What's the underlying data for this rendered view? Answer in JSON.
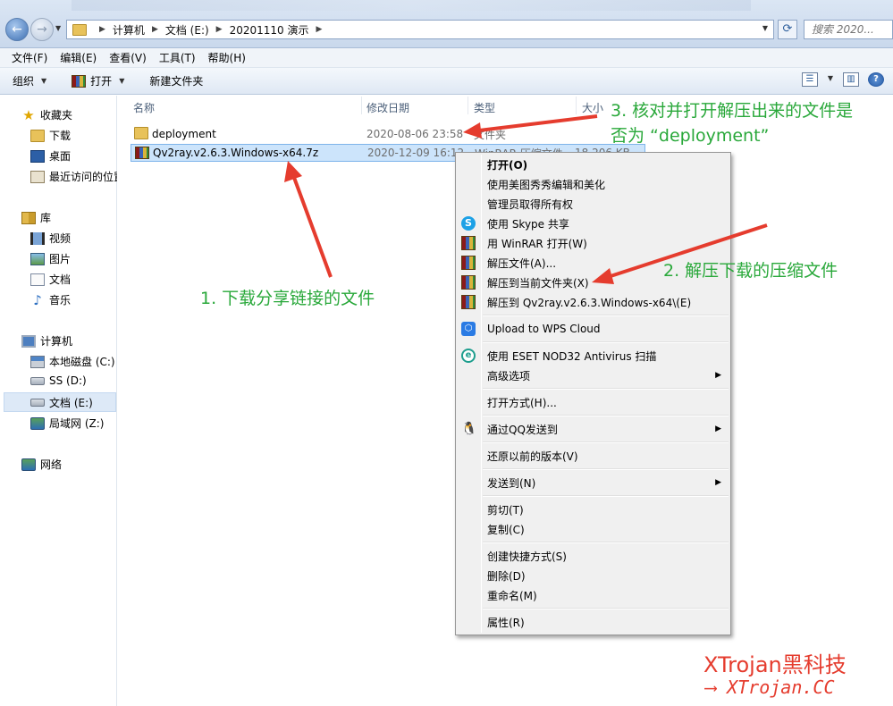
{
  "address": {
    "crumbs": [
      "计算机",
      "文档 (E:)",
      "20201110 演示"
    ]
  },
  "search": {
    "placeholder": "搜索 2020..."
  },
  "menubar": [
    "文件(F)",
    "编辑(E)",
    "查看(V)",
    "工具(T)",
    "帮助(H)"
  ],
  "toolbar": {
    "organize": "组织",
    "open": "打开",
    "new_folder": "新建文件夹"
  },
  "sidebar": {
    "favorites": "收藏夹",
    "fav_items": [
      "下载",
      "桌面",
      "最近访问的位置"
    ],
    "library": "库",
    "lib_items": [
      "视频",
      "图片",
      "文档",
      "音乐"
    ],
    "computer": "计算机",
    "drives": [
      "本地磁盘 (C:)",
      "SS (D:)",
      "文档 (E:)",
      "局域网 (Z:)"
    ],
    "network": "网络"
  },
  "columns": {
    "name": "名称",
    "date": "修改日期",
    "type": "类型",
    "size": "大小"
  },
  "files": [
    {
      "name": "deployment",
      "date": "2020-08-06 23:58",
      "type": "文件夹",
      "size": ""
    },
    {
      "name": "Qv2ray.v2.6.3.Windows-x64.7z",
      "date": "2020-12-09 16:12",
      "type": "WinRAR 压缩文件",
      "size": "18,206 KB"
    }
  ],
  "context_menu": {
    "items": [
      "打开(O)",
      "使用美图秀秀编辑和美化",
      "管理员取得所有权",
      "使用 Skype 共享",
      "用 WinRAR 打开(W)",
      "解压文件(A)...",
      "解压到当前文件夹(X)",
      "解压到 Qv2ray.v2.6.3.Windows-x64\\(E)",
      "Upload to WPS Cloud",
      "使用 ESET NOD32 Antivirus 扫描",
      "高级选项",
      "打开方式(H)...",
      "通过QQ发送到",
      "还原以前的版本(V)",
      "发送到(N)",
      "剪切(T)",
      "复制(C)",
      "创建快捷方式(S)",
      "删除(D)",
      "重命名(M)",
      "属性(R)"
    ]
  },
  "annotations": {
    "step1": "1. 下载分享链接的文件",
    "step2": "2. 解压下载的压缩文件",
    "step3_line1": "3. 核对并打开解压出来的文件是",
    "step3_line2": "否为 “deployment”"
  },
  "watermark": {
    "line1": "XTrojan黑科技",
    "line2": "⟶ XTrojan.CC"
  },
  "colors": {
    "annotation": "#29a83a",
    "arrow": "#e53c2e",
    "watermark": "#e53c2e"
  }
}
